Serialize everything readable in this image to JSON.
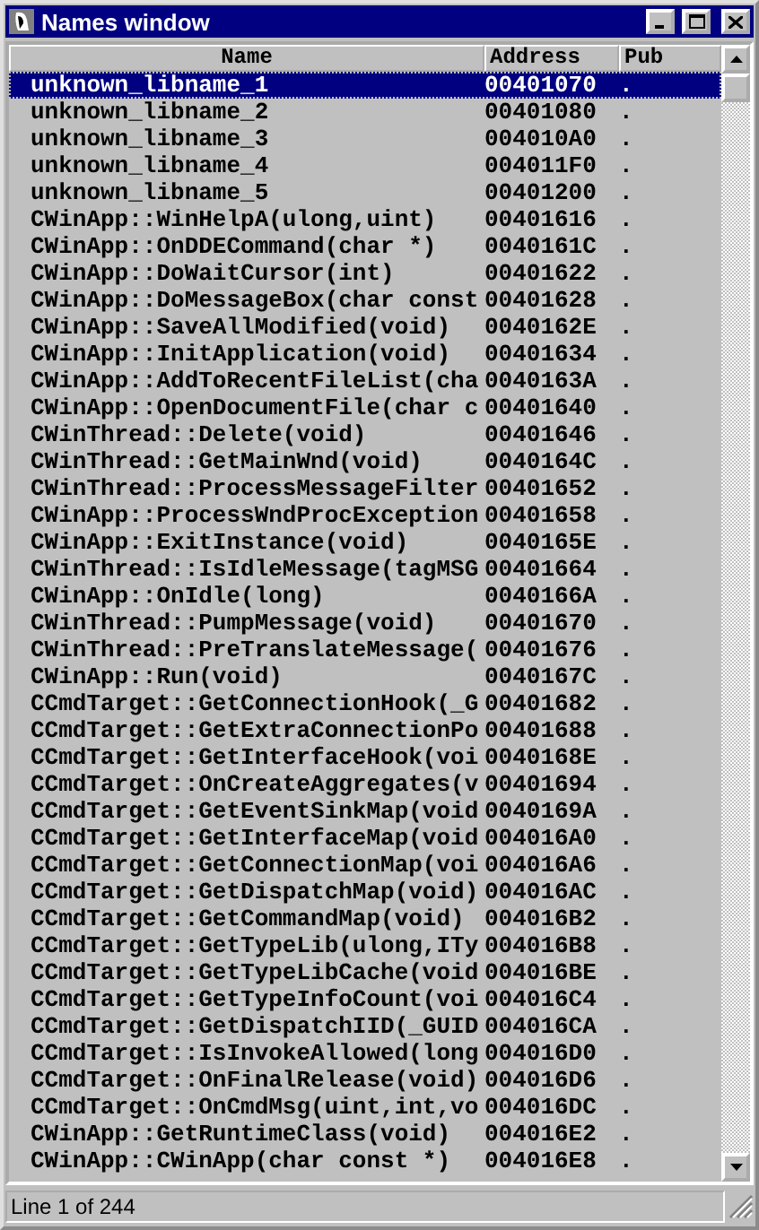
{
  "window": {
    "title": "Names window"
  },
  "table": {
    "columns": [
      "Name",
      "Address",
      "Pub"
    ],
    "rows": [
      {
        "name": "unknown_libname_1",
        "address": "00401070",
        "pub": ".",
        "selected": true
      },
      {
        "name": "unknown_libname_2",
        "address": "00401080",
        "pub": ".",
        "selected": false
      },
      {
        "name": "unknown_libname_3",
        "address": "004010A0",
        "pub": ".",
        "selected": false
      },
      {
        "name": "unknown_libname_4",
        "address": "004011F0",
        "pub": ".",
        "selected": false
      },
      {
        "name": "unknown_libname_5",
        "address": "00401200",
        "pub": ".",
        "selected": false
      },
      {
        "name": "CWinApp::WinHelpA(ulong,uint)",
        "address": "00401616",
        "pub": ".",
        "selected": false
      },
      {
        "name": "CWinApp::OnDDECommand(char *)",
        "address": "0040161C",
        "pub": ".",
        "selected": false
      },
      {
        "name": "CWinApp::DoWaitCursor(int)",
        "address": "00401622",
        "pub": ".",
        "selected": false
      },
      {
        "name": "CWinApp::DoMessageBox(char const",
        "address": "00401628",
        "pub": ".",
        "selected": false
      },
      {
        "name": "CWinApp::SaveAllModified(void)",
        "address": "0040162E",
        "pub": ".",
        "selected": false
      },
      {
        "name": "CWinApp::InitApplication(void)",
        "address": "00401634",
        "pub": ".",
        "selected": false
      },
      {
        "name": "CWinApp::AddToRecentFileList(cha",
        "address": "0040163A",
        "pub": ".",
        "selected": false
      },
      {
        "name": "CWinApp::OpenDocumentFile(char c",
        "address": "00401640",
        "pub": ".",
        "selected": false
      },
      {
        "name": "CWinThread::Delete(void)",
        "address": "00401646",
        "pub": ".",
        "selected": false
      },
      {
        "name": "CWinThread::GetMainWnd(void)",
        "address": "0040164C",
        "pub": ".",
        "selected": false
      },
      {
        "name": "CWinThread::ProcessMessageFilter",
        "address": "00401652",
        "pub": ".",
        "selected": false
      },
      {
        "name": "CWinApp::ProcessWndProcException",
        "address": "00401658",
        "pub": ".",
        "selected": false
      },
      {
        "name": "CWinApp::ExitInstance(void)",
        "address": "0040165E",
        "pub": ".",
        "selected": false
      },
      {
        "name": "CWinThread::IsIdleMessage(tagMSG",
        "address": "00401664",
        "pub": ".",
        "selected": false
      },
      {
        "name": "CWinApp::OnIdle(long)",
        "address": "0040166A",
        "pub": ".",
        "selected": false
      },
      {
        "name": "CWinThread::PumpMessage(void)",
        "address": "00401670",
        "pub": ".",
        "selected": false
      },
      {
        "name": "CWinThread::PreTranslateMessage(",
        "address": "00401676",
        "pub": ".",
        "selected": false
      },
      {
        "name": "CWinApp::Run(void)",
        "address": "0040167C",
        "pub": ".",
        "selected": false
      },
      {
        "name": "CCmdTarget::GetConnectionHook(_G",
        "address": "00401682",
        "pub": ".",
        "selected": false
      },
      {
        "name": "CCmdTarget::GetExtraConnectionPo",
        "address": "00401688",
        "pub": ".",
        "selected": false
      },
      {
        "name": "CCmdTarget::GetInterfaceHook(voi",
        "address": "0040168E",
        "pub": ".",
        "selected": false
      },
      {
        "name": "CCmdTarget::OnCreateAggregates(v",
        "address": "00401694",
        "pub": ".",
        "selected": false
      },
      {
        "name": "CCmdTarget::GetEventSinkMap(void",
        "address": "0040169A",
        "pub": ".",
        "selected": false
      },
      {
        "name": "CCmdTarget::GetInterfaceMap(void",
        "address": "004016A0",
        "pub": ".",
        "selected": false
      },
      {
        "name": "CCmdTarget::GetConnectionMap(voi",
        "address": "004016A6",
        "pub": ".",
        "selected": false
      },
      {
        "name": "CCmdTarget::GetDispatchMap(void)",
        "address": "004016AC",
        "pub": ".",
        "selected": false
      },
      {
        "name": "CCmdTarget::GetCommandMap(void)",
        "address": "004016B2",
        "pub": ".",
        "selected": false
      },
      {
        "name": "CCmdTarget::GetTypeLib(ulong,ITy",
        "address": "004016B8",
        "pub": ".",
        "selected": false
      },
      {
        "name": "CCmdTarget::GetTypeLibCache(void",
        "address": "004016BE",
        "pub": ".",
        "selected": false
      },
      {
        "name": "CCmdTarget::GetTypeInfoCount(voi",
        "address": "004016C4",
        "pub": ".",
        "selected": false
      },
      {
        "name": "CCmdTarget::GetDispatchIID(_GUID",
        "address": "004016CA",
        "pub": ".",
        "selected": false
      },
      {
        "name": "CCmdTarget::IsInvokeAllowed(long",
        "address": "004016D0",
        "pub": ".",
        "selected": false
      },
      {
        "name": "CCmdTarget::OnFinalRelease(void)",
        "address": "004016D6",
        "pub": ".",
        "selected": false
      },
      {
        "name": "CCmdTarget::OnCmdMsg(uint,int,vo",
        "address": "004016DC",
        "pub": ".",
        "selected": false
      },
      {
        "name": "CWinApp::GetRuntimeClass(void)",
        "address": "004016E2",
        "pub": ".",
        "selected": false
      },
      {
        "name": "CWinApp::CWinApp(char const *)",
        "address": "004016E8",
        "pub": ".",
        "selected": false
      }
    ]
  },
  "status_bar": "Line 1 of 244"
}
